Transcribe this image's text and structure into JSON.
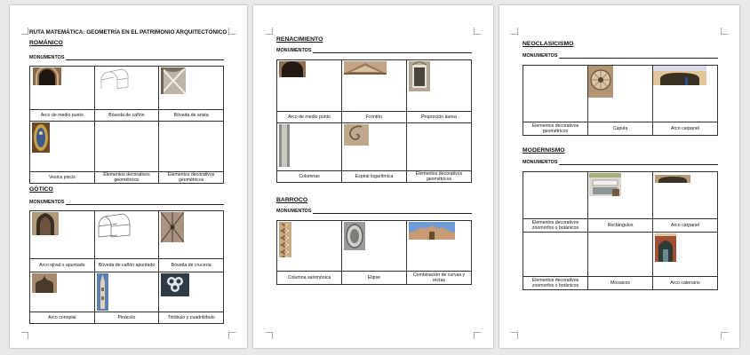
{
  "document_title": "RUTA MATEMÁTICA: GEOMETRÍA EN EL PATRIMONIO ARQUITECTÓNICO",
  "monuments_label": "MONUMENTOS",
  "sections": {
    "romanico": {
      "title": "ROMÁNICO",
      "row1": [
        "Arco de medio punto",
        "Bóveda de cañón",
        "Bóveda de arista"
      ],
      "row2": [
        "Vesica piscis",
        "Elementos decorativos geométricos",
        "Elementos decorativos geométricos"
      ]
    },
    "gotico": {
      "title": "GÓTICO",
      "row1": [
        "Arco ojival o apuntado",
        "Bóveda de cañón apuntado",
        "Bóveda de crucería"
      ],
      "row2": [
        "Arco conopial",
        "Pináculo",
        "Trilóbulo y cuadrilóbulo"
      ]
    },
    "renacimiento": {
      "title": "RENACIMIENTO",
      "row1": [
        "Arco de medio punto",
        "Frontón",
        "Proporción áurea"
      ],
      "row2": [
        "Columnas",
        "Espiral logarítmica",
        "Elementos decorativos geométricos"
      ]
    },
    "barroco": {
      "title": "BARROCO",
      "row1": [
        "Columna salomónica",
        "Elipse",
        "Combinación de curvas y rectas"
      ]
    },
    "neoclasicismo": {
      "title": "NEOCLASICISMO",
      "row1": [
        "Elementos decorativos geométricos",
        "Cúpula",
        "Arco carpanel"
      ]
    },
    "modernismo": {
      "title": "MODERNISMO",
      "row1": [
        "Elementos decorativos zoomorfos o botánicos",
        "Rectángulos",
        "Arco carpanel"
      ],
      "row2": [
        "Elementos decorativos zoomorfos o botánicos",
        "Mosaicos",
        "Arco catenario"
      ]
    }
  }
}
